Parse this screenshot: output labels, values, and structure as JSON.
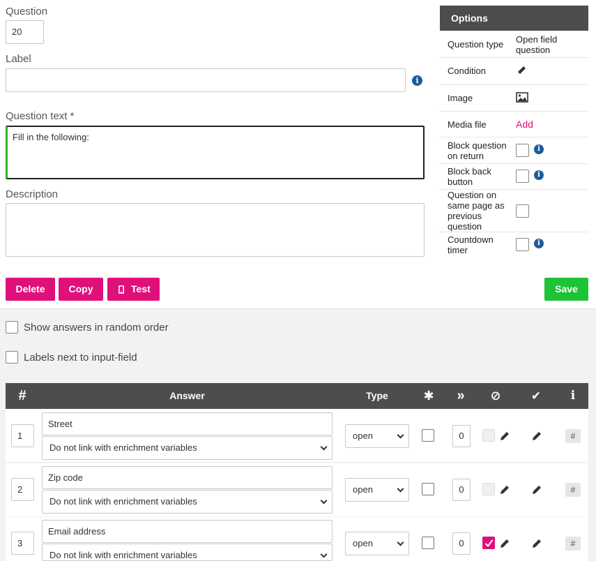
{
  "form": {
    "question_label": "Question",
    "question_value": "20",
    "label_label": "Label",
    "label_value": "",
    "question_text_label": "Question text *",
    "question_text_value": "Fill in the following:",
    "description_label": "Description",
    "description_value": ""
  },
  "buttons": {
    "delete": "Delete",
    "copy": "Copy",
    "test": "Test",
    "save": "Save"
  },
  "options": {
    "header": "Options",
    "question_type_label": "Question type",
    "question_type_value": "Open field question",
    "condition_label": "Condition",
    "image_label": "Image",
    "media_file_label": "Media file",
    "media_file_action": "Add",
    "block_question_label": "Block question on return",
    "block_back_label": "Block back button",
    "same_page_label": "Question on same page as previous question",
    "countdown_label": "Countdown timer"
  },
  "settings": {
    "random_order": "Show answers in random order",
    "labels_next": "Labels next to input-field"
  },
  "table": {
    "headers": {
      "hash": "#",
      "answer": "Answer",
      "type": "Type",
      "required": "✱",
      "skip": "»",
      "exclusive": "⊘",
      "correct": "✔",
      "info": "i"
    },
    "rows": [
      {
        "num": "1",
        "answer": "Street",
        "link": "Do not link with enrichment variables",
        "type": "open",
        "count": "0",
        "exclusive_checked": false,
        "hash": "#"
      },
      {
        "num": "2",
        "answer": "Zip code",
        "link": "Do not link with enrichment variables",
        "type": "open",
        "count": "0",
        "exclusive_checked": false,
        "hash": "#"
      },
      {
        "num": "3",
        "answer": "Email address",
        "link": "Do not link with enrichment variables",
        "type": "open",
        "count": "0",
        "exclusive_checked": true,
        "hash": "#"
      }
    ]
  },
  "colors": {
    "accent": "#e0107a",
    "save": "#1ec337",
    "header": "#4d4d4d",
    "info": "#1d5c9b"
  }
}
